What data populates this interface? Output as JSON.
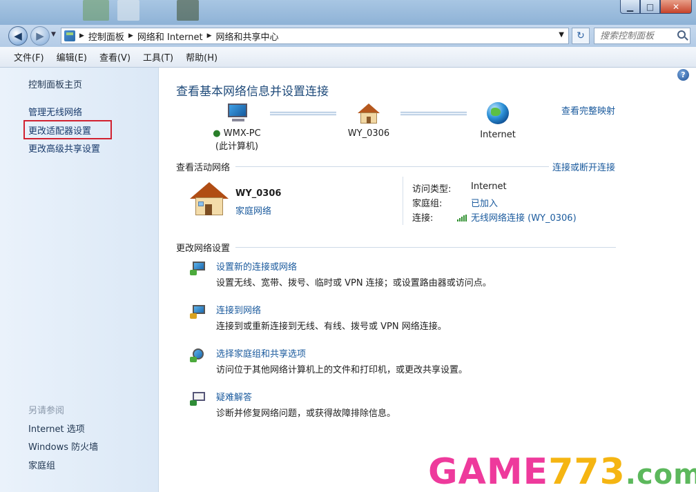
{
  "window": {
    "minimize": "▁",
    "maximize": "□",
    "close": "✕"
  },
  "address": {
    "back_symbol": "◀",
    "forward_symbol": "▶",
    "breadcrumb": [
      "控制面板",
      "网络和 Internet",
      "网络和共享中心"
    ],
    "refresh_symbol": "↻",
    "search_placeholder": "搜索控制面板"
  },
  "menu": [
    "文件(F)",
    "编辑(E)",
    "查看(V)",
    "工具(T)",
    "帮助(H)"
  ],
  "sidebar": {
    "links": [
      "控制面板主页",
      "管理无线网络",
      "更改适配器设置",
      "更改高级共享设置"
    ],
    "see_also_heading": "另请参阅",
    "see_also": [
      "Internet 选项",
      "Windows 防火墙",
      "家庭组"
    ]
  },
  "main": {
    "help": "?",
    "title": "查看基本网络信息并设置连接",
    "map_link": "查看完整映射",
    "nodes": {
      "pc_name": "WMX-PC",
      "pc_sub": "(此计算机)",
      "network": "WY_0306",
      "internet": "Internet"
    },
    "active": {
      "heading": "查看活动网络",
      "link": "连接或断开连接",
      "network_name": "WY_0306",
      "network_type": "家庭网络",
      "access_type_label": "访问类型:",
      "access_type_value": "Internet",
      "homegroup_label": "家庭组:",
      "homegroup_value": "已加入",
      "connection_label": "连接:",
      "connection_value": "无线网络连接 (WY_0306)"
    },
    "change": {
      "heading": "更改网络设置",
      "tasks": [
        {
          "title": "设置新的连接或网络",
          "desc": "设置无线、宽带、拨号、临时或 VPN 连接；或设置路由器或访问点。"
        },
        {
          "title": "连接到网络",
          "desc": "连接到或重新连接到无线、有线、拨号或 VPN 网络连接。"
        },
        {
          "title": "选择家庭组和共享选项",
          "desc": "访问位于其他网络计算机上的文件和打印机，或更改共享设置。"
        },
        {
          "title": "疑难解答",
          "desc": "诊断并修复网络问题，或获得故障排除信息。"
        }
      ]
    }
  },
  "watermark": {
    "part1": "GAME",
    "part2": "773",
    "part3": ".com"
  },
  "colors": {
    "link": "#1a5a9d",
    "highlight_box": "#d1202f"
  }
}
